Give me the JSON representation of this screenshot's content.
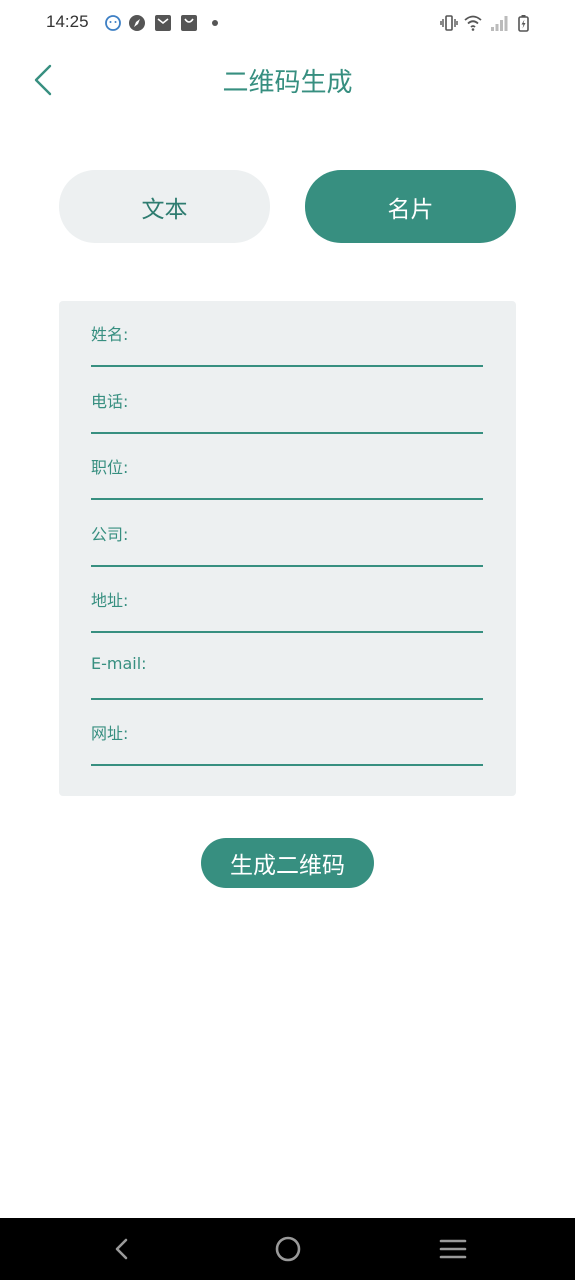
{
  "status_bar": {
    "time": "14:25",
    "left_icons": [
      "smiley-badge-icon",
      "compass-icon",
      "mail-icon",
      "bag-icon",
      "dot-icon"
    ],
    "right_icons": [
      "vibrate-icon",
      "wifi-icon",
      "signal-icon",
      "battery-charging-icon"
    ]
  },
  "header": {
    "title": "二维码生成",
    "back_icon": "chevron-left-icon"
  },
  "tabs": [
    {
      "label": "文本",
      "selected": false
    },
    {
      "label": "名片",
      "selected": true
    }
  ],
  "form": {
    "fields": [
      {
        "label": "姓名:",
        "value": ""
      },
      {
        "label": "电话:",
        "value": ""
      },
      {
        "label": "职位:",
        "value": ""
      },
      {
        "label": "公司:",
        "value": ""
      },
      {
        "label": "地址:",
        "value": ""
      },
      {
        "label": "E-mail:",
        "value": ""
      },
      {
        "label": "网址:",
        "value": ""
      }
    ]
  },
  "generate_button": {
    "label": "生成二维码"
  },
  "nav_bar": {
    "back_icon": "nav-back-icon",
    "home_icon": "nav-home-icon",
    "menu_icon": "nav-menu-icon"
  },
  "colors": {
    "accent": "#378f80",
    "panel": "#edf0f1",
    "nav_bg": "#000000"
  }
}
